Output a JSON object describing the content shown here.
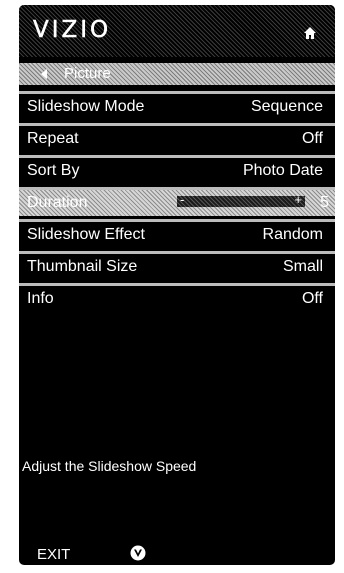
{
  "header": {
    "logo_text": "VIZIO",
    "home_icon": "home-icon"
  },
  "breadcrumb": {
    "back_icon": "left-arrow-icon",
    "label": "Picture"
  },
  "settings": [
    {
      "label": "Slideshow Mode",
      "value": "Sequence"
    },
    {
      "label": "Repeat",
      "value": "Off"
    },
    {
      "label": "Sort By",
      "value": "Photo Date"
    },
    {
      "label": "Duration",
      "value": "5"
    },
    {
      "label": "Slideshow Effect",
      "value": "Random"
    },
    {
      "label": "Thumbnail Size",
      "value": "Small"
    },
    {
      "label": "Info",
      "value": "Off"
    }
  ],
  "duration_slider": {
    "minus": "-",
    "plus": "+"
  },
  "help": {
    "text": "Adjust the Slideshow Speed"
  },
  "footer": {
    "exit_label": "EXIT",
    "v_icon": "vizio-v-icon"
  },
  "colors": {
    "background": "#000000",
    "text": "#ffffff",
    "divider": "#bcbcbc",
    "selected_highlight": "#b0b0b0"
  }
}
